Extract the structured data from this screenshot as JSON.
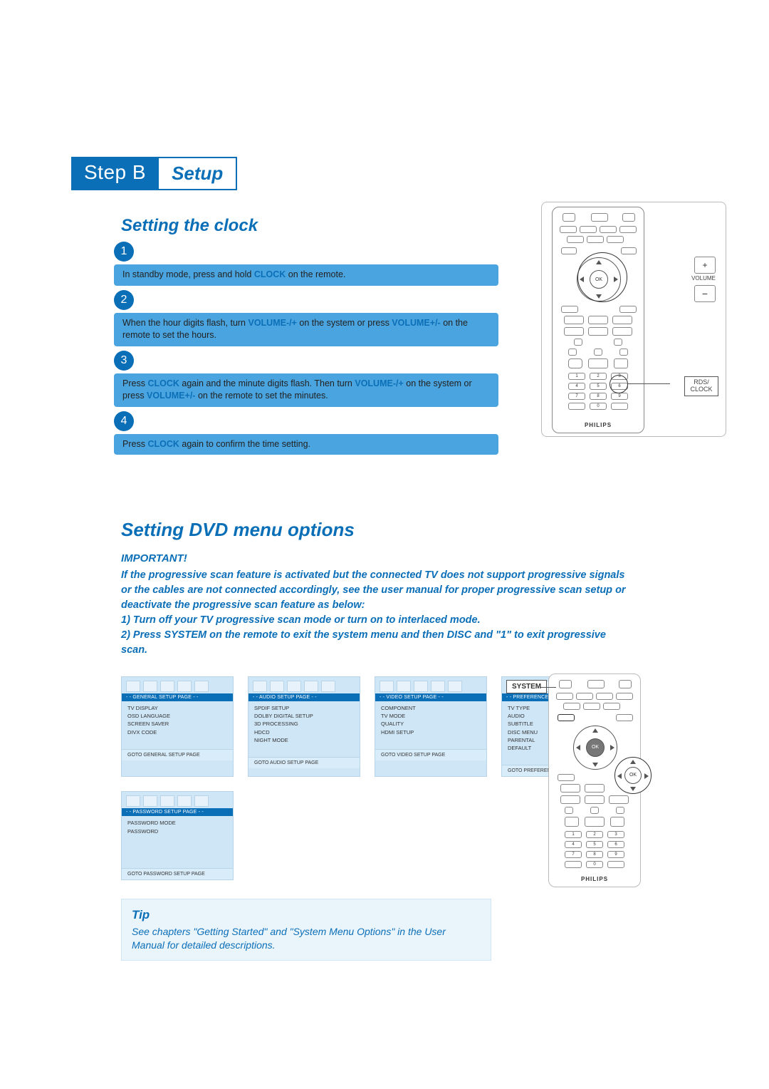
{
  "step": {
    "label": "Step B",
    "title": "Setup"
  },
  "clock_section": {
    "title": "Setting the clock",
    "steps": [
      {
        "num": "1",
        "text_before": "In standby mode, press and hold ",
        "kw1": "CLOCK",
        "text_after": " on the remote."
      },
      {
        "num": "2",
        "text_before": "When the hour digits flash, turn ",
        "kw1": "VOLUME-/+",
        "text_mid": " on the system or press ",
        "kw2": "VOLUME+/-",
        "text_after": " on the remote to set the hours."
      },
      {
        "num": "3",
        "text_before": "Press ",
        "kw1": "CLOCK",
        "text_mid": " again and the minute digits flash. Then turn ",
        "kw2": "VOLUME-/+",
        "text_mid2": " on the system or press ",
        "kw3": "VOLUME+/-",
        "text_after": " on the remote to set the minutes."
      },
      {
        "num": "4",
        "text_before": "Press ",
        "kw1": "CLOCK",
        "text_after": " again to confirm the time setting."
      }
    ]
  },
  "callout_top": {
    "ok_label": "OK",
    "volume_label": "VOLUME",
    "plus": "+",
    "minus": "−",
    "rds_clock": "RDS/\nCLOCK",
    "brand": "PHILIPS"
  },
  "dvd_section": {
    "title": "Setting DVD menu options",
    "important_heading": "IMPORTANT!",
    "important_body": "If the progressive scan feature is activated but the connected TV does not support progressive signals or the cables are not connected accordingly, see the user manual for proper progressive scan setup or deactivate the progressive scan feature as below:",
    "important_list1": "1) Turn off your TV progressive scan mode or turn on to interlaced mode.",
    "important_list2": "2) Press SYSTEM on the remote to exit the system menu and then DISC and \"1\" to exit progressive scan."
  },
  "menus": [
    {
      "banner": "- - GENERAL SETUP PAGE - -",
      "items": [
        "TV DISPLAY",
        "OSD LANGUAGE",
        "SCREEN SAVER",
        "DIVX CODE"
      ],
      "foot": "GOTO GENERAL SETUP PAGE"
    },
    {
      "banner": "- - AUDIO SETUP PAGE - -",
      "items": [
        "SPDIF SETUP",
        "DOLBY DIGITAL SETUP",
        "3D PROCESSING",
        "HDCD",
        "NIGHT MODE"
      ],
      "foot": "GOTO AUDIO SETUP PAGE"
    },
    {
      "banner": "- - VIDEO SETUP PAGE - -",
      "items": [
        "COMPONENT",
        "TV MODE",
        "QUALITY",
        "HDMI SETUP"
      ],
      "foot": "GOTO VIDEO SETUP PAGE"
    },
    {
      "banner": "- - PREFERENCE PAGE - -",
      "items": [
        "TV TYPE",
        "AUDIO",
        "SUBTITLE",
        "DISC MENU",
        "PARENTAL",
        "DEFAULT"
      ],
      "foot": "GOTO PREFERENCE PAGE"
    },
    {
      "banner": "- - PASSWORD SETUP PAGE - -",
      "items": [
        "PASSWORD MODE",
        "PASSWORD"
      ],
      "foot": "GOTO PASSWORD SETUP PAGE"
    }
  ],
  "tip": {
    "title": "Tip",
    "body": "See chapters \"Getting Started\" and \"System Menu Options\" in the User Manual for detailed descriptions."
  },
  "callout_bottom": {
    "system_label": "SYSTEM",
    "ok_label": "OK",
    "brand": "PHILIPS"
  }
}
